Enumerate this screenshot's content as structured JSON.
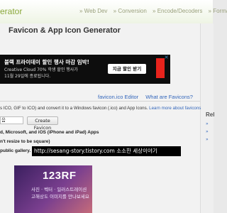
{
  "header": {
    "logo_text": "erator",
    "nav": [
      "» Web Dev",
      "» Conversion",
      "» Encode/Decoders",
      "» Formatt"
    ]
  },
  "page": {
    "title": "Favicon & App Icon Generator"
  },
  "ad_top": {
    "headline": "블랙 프라이데이 할인 행사 마감 임박!",
    "sub1": "Creative Cloud 70% 학생 할인 행사가",
    "sub2": "11월 29일에 종료됩니다.",
    "button": "지금 할인 받기",
    "brand": "Adobe",
    "close": "✕"
  },
  "tabs": [
    "favicon.ico Editor",
    "What are Favicons?"
  ],
  "description": {
    "text": "s ICO, GIF to ICO) and convert it to a Windows favicon (.ico) and App Icons.",
    "link": "Learn more about favicons"
  },
  "form": {
    "file_value": "음",
    "create_button": "Create Favicon"
  },
  "options": [
    "d, Microsoft, and iOS (iPhone and iPad) Apps",
    "n't resize to be square)",
    "public gallery."
  ],
  "overlay_url": "http://sesang-story.tistory.com 소소한 세상이야기",
  "sidebar": {
    "heading": "Rel",
    "items": [
      "»",
      "»",
      "»"
    ]
  },
  "ad_bottom": {
    "logo": "123RF",
    "line1": "사진 · 벡터 · 일러스트레이션",
    "line2": "고해상도 이미지를 만나보세요"
  }
}
